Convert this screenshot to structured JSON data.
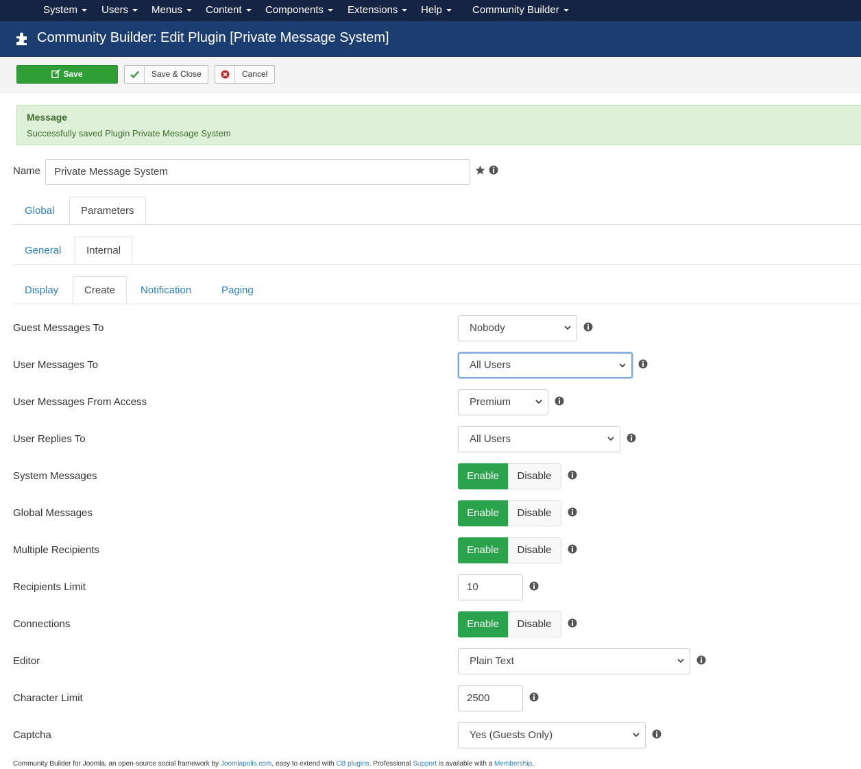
{
  "menu": {
    "items": [
      "System",
      "Users",
      "Menus",
      "Content",
      "Components",
      "Extensions",
      "Help",
      "Community Builder"
    ]
  },
  "header": {
    "title": "Community Builder: Edit Plugin [Private Message System]",
    "icon": "puzzle-icon"
  },
  "toolbar": {
    "save_label": "Save",
    "save_close_label": "Save & Close",
    "cancel_label": "Cancel"
  },
  "alert": {
    "heading": "Message",
    "text": "Successfully saved Plugin Private Message System"
  },
  "name": {
    "label": "Name",
    "value": "Private Message System"
  },
  "tabs": {
    "level1": [
      "Global",
      "Parameters"
    ],
    "level2": [
      "General",
      "Internal"
    ],
    "level3": [
      "Display",
      "Create",
      "Notification",
      "Paging"
    ]
  },
  "fields": {
    "guest_messages_to": {
      "label": "Guest Messages To",
      "value": "Nobody"
    },
    "user_messages_to": {
      "label": "User Messages To",
      "value": "All Users"
    },
    "user_messages_from_access": {
      "label": "User Messages From Access",
      "value": "Premium"
    },
    "user_replies_to": {
      "label": "User Replies To",
      "value": "All Users"
    },
    "system_messages": {
      "label": "System Messages",
      "on": "Enable",
      "off": "Disable"
    },
    "global_messages": {
      "label": "Global Messages",
      "on": "Enable",
      "off": "Disable"
    },
    "multiple_recipients": {
      "label": "Multiple Recipients",
      "on": "Enable",
      "off": "Disable"
    },
    "recipients_limit": {
      "label": "Recipients Limit",
      "value": "10"
    },
    "connections": {
      "label": "Connections",
      "on": "Enable",
      "off": "Disable"
    },
    "editor": {
      "label": "Editor",
      "value": "Plain Text"
    },
    "character_limit": {
      "label": "Character Limit",
      "value": "2500"
    },
    "captcha": {
      "label": "Captcha",
      "value": "Yes (Guests Only)"
    }
  },
  "footer": {
    "t1": "Community Builder for Joomla, an open-source social framework by ",
    "l1": "Joomlapolis.com",
    "t2": ", easy to extend with ",
    "l2": "CB plugins",
    "t3": ". Professional ",
    "l3": "Support",
    "t4": " is available with a ",
    "l4": "Membership",
    "t5": "."
  },
  "colors": {
    "topbar": "#152344",
    "titlebar": "#1c3d6f",
    "save_button": "#2f9e35",
    "toggle_on": "#2ba24c",
    "link": "#2a7fc1",
    "alert_bg": "#dff0d8"
  }
}
